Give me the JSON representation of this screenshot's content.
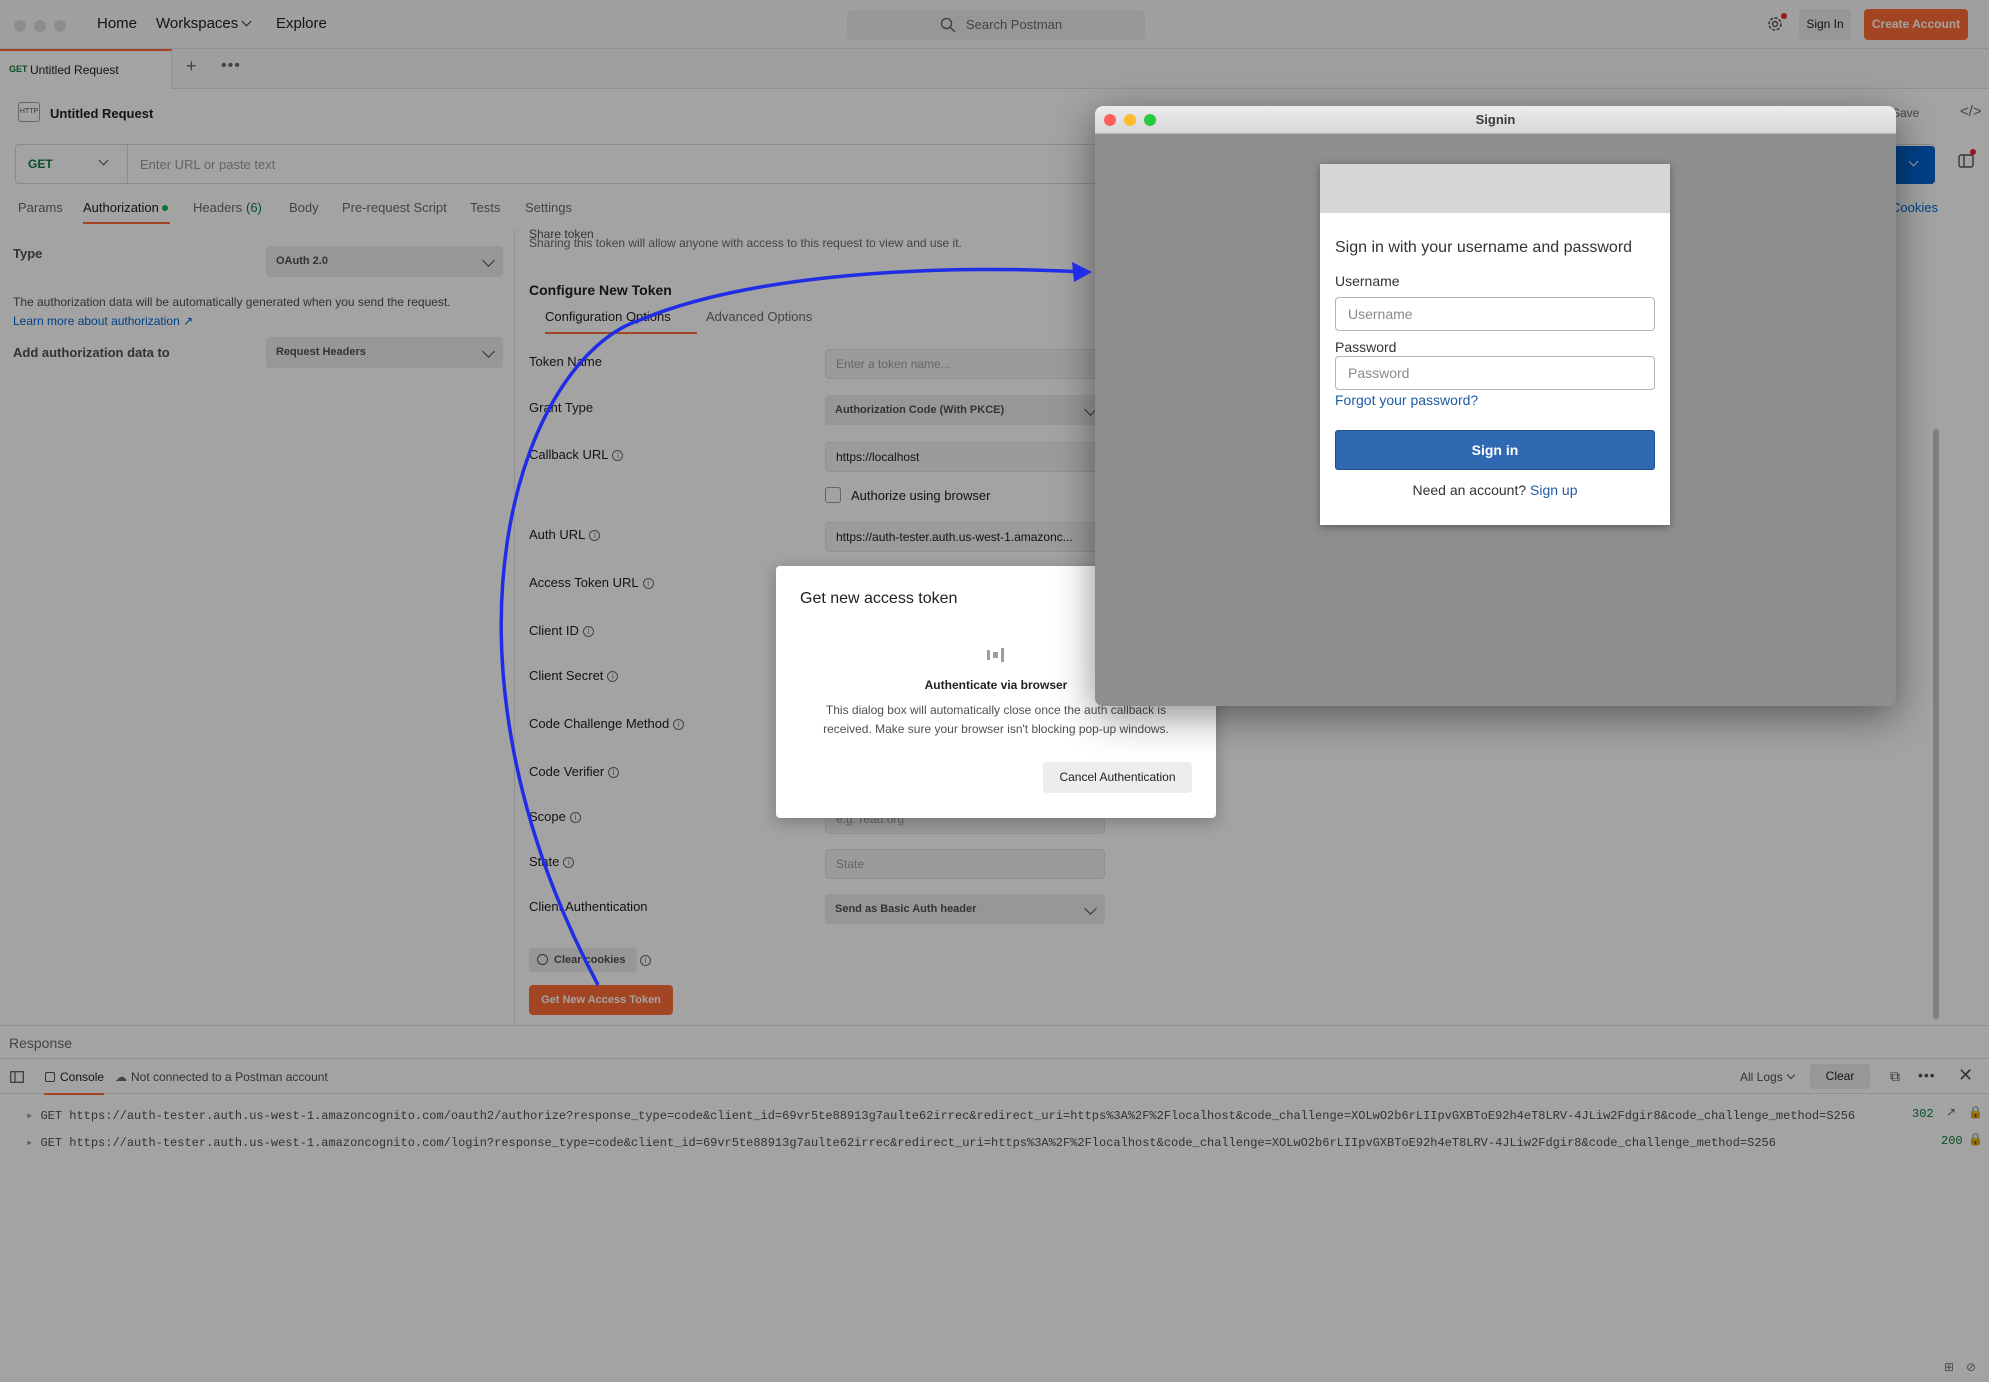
{
  "app": {
    "nav": {
      "home": "Home",
      "workspaces": "Workspaces",
      "explore": "Explore"
    },
    "search_placeholder": "Search Postman",
    "sign_in": "Sign In",
    "create_account": "Create Account"
  },
  "tabs": {
    "active": {
      "method": "GET",
      "title": "Untitled Request"
    }
  },
  "request": {
    "title": "Untitled Request",
    "method": "GET",
    "url_placeholder": "Enter URL or paste text",
    "save_label": "Save",
    "cookies_label": "Cookies",
    "subtabs": [
      "Params",
      "Authorization",
      "Headers",
      "Body",
      "Pre-request Script",
      "Tests",
      "Settings"
    ],
    "headers_count": "(6)"
  },
  "auth": {
    "type_label": "Type",
    "type_value": "OAuth 2.0",
    "description": "The authorization data will be automatically generated when you send the request.",
    "learn_more": "Learn more about authorization ↗",
    "add_to_label": "Add authorization data to",
    "add_to_value": "Request Headers",
    "share_token_title": "Share token",
    "share_token_desc": "Sharing this token will allow anyone with access to this request to view and use it.",
    "configure_title": "Configure New Token",
    "config_tabs": [
      "Configuration Options",
      "Advanced Options"
    ],
    "fields": {
      "token_name": {
        "label": "Token Name",
        "placeholder": "Enter a token name..."
      },
      "grant_type": {
        "label": "Grant Type",
        "value": "Authorization Code (With PKCE)"
      },
      "callback_url": {
        "label": "Callback URL",
        "value": "https://localhost"
      },
      "authorize_browser": "Authorize using browser",
      "auth_url": {
        "label": "Auth URL",
        "value": "https://auth-tester.auth.us-west-1.amazonc..."
      },
      "access_token_url": {
        "label": "Access Token URL"
      },
      "client_id": {
        "label": "Client ID"
      },
      "client_secret": {
        "label": "Client Secret"
      },
      "code_challenge": {
        "label": "Code Challenge Method"
      },
      "code_verifier": {
        "label": "Code Verifier"
      },
      "scope": {
        "label": "Scope",
        "placeholder": "e.g. read:org"
      },
      "state": {
        "label": "State",
        "placeholder": "State"
      },
      "client_auth": {
        "label": "Client Authentication",
        "value": "Send as Basic Auth header"
      }
    },
    "clear_cookies": "Clear cookies",
    "get_token": "Get New Access Token"
  },
  "response": {
    "label": "Response"
  },
  "console": {
    "tab": "Console",
    "status": "Not connected to a Postman account",
    "filter": "All Logs",
    "clear": "Clear",
    "logs": [
      {
        "text": "GET https://auth-tester.auth.us-west-1.amazoncognito.com/oauth2/authorize?response_type=code&client_id=69vr5te88913g7aulte62irrec&redirect_uri=https%3A%2F%2Flocalhost&code_challenge=XOLwO2b6rLIIpvGXBToE92h4eT8LRV-4JLiw2Fdgir8&code_challenge_method=S256",
        "status": "302"
      },
      {
        "text": "GET https://auth-tester.auth.us-west-1.amazoncognito.com/login?response_type=code&client_id=69vr5te88913g7aulte62irrec&redirect_uri=https%3A%2F%2Flocalhost&code_challenge=XOLwO2b6rLIIpvGXBToE92h4eT8LRV-4JLiw2Fdgir8&code_challenge_method=S256",
        "status": "200"
      }
    ]
  },
  "modal": {
    "title": "Get new access token",
    "subtitle": "Authenticate via browser",
    "body": "This dialog box will automatically close once the auth callback is received. Make sure your browser isn't blocking pop-up windows.",
    "cancel": "Cancel Authentication"
  },
  "signin": {
    "window_title": "Signin",
    "heading": "Sign in with your username and password",
    "username_label": "Username",
    "username_placeholder": "Username",
    "password_label": "Password",
    "password_placeholder": "Password",
    "forgot": "Forgot your password?",
    "button": "Sign in",
    "need_account": "Need an account?",
    "signup": "Sign up"
  },
  "colors": {
    "accent": "#ff6c37",
    "link": "#0265d2",
    "cognito_blue": "#2e69b1",
    "annotation_arrow": "#1f2ee6"
  }
}
